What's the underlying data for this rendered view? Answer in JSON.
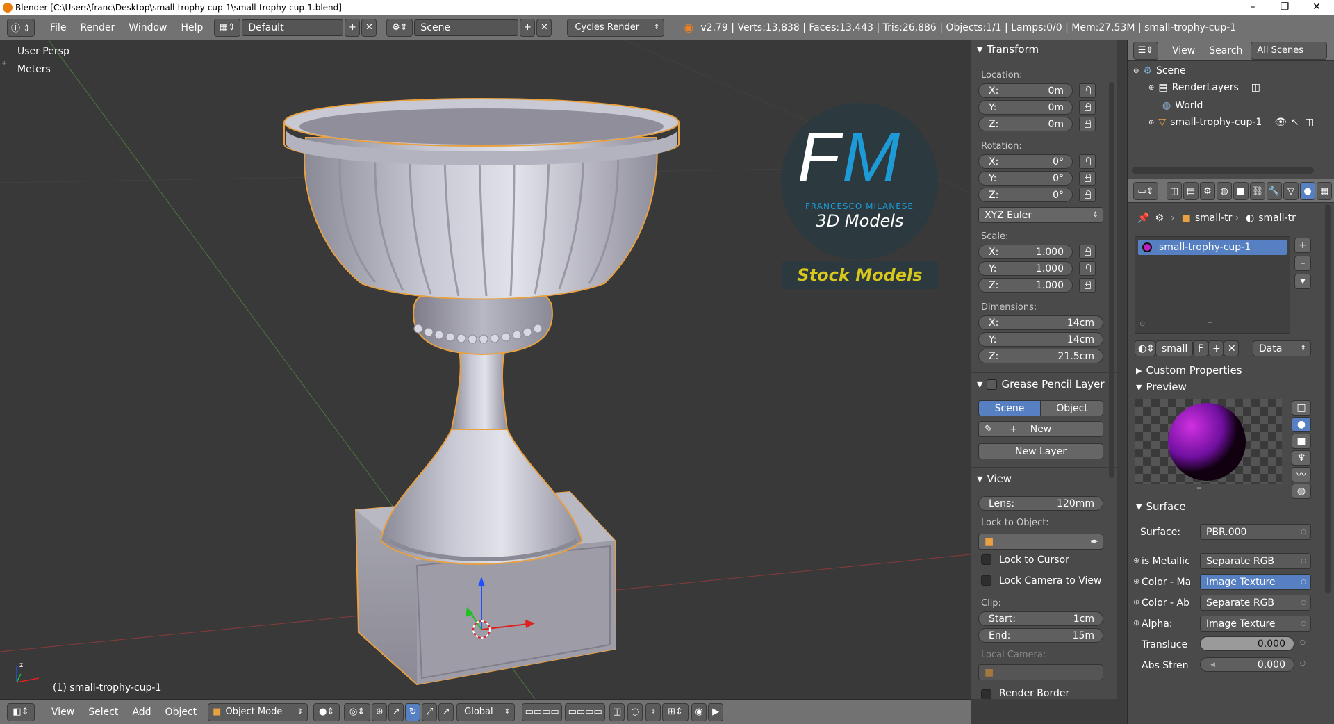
{
  "titlebar": {
    "title": "Blender [C:\\Users\\franc\\Desktop\\small-trophy-cup-1\\small-trophy-cup-1.blend]",
    "minimize": "–",
    "maximize": "❐",
    "close": "✕"
  },
  "header": {
    "menus": [
      "File",
      "Render",
      "Window",
      "Help"
    ],
    "layout": "Default",
    "scene": "Scene",
    "engine": "Cycles Render",
    "stats": "v2.79 | Verts:13,838 | Faces:13,443 | Tris:26,886 | Objects:1/1 | Lamps:0/0 | Mem:27.53M | small-trophy-cup-1"
  },
  "viewport": {
    "view_name": "User Persp",
    "units": "Meters",
    "object_label": "(1) small-trophy-cup-1",
    "watermark": {
      "initials_f": "F",
      "initials_m": "M",
      "name": "FRANCESCO MILANESE",
      "sub": "3D Models",
      "banner": "Stock Models"
    }
  },
  "bottombar": {
    "menus": [
      "View",
      "Select",
      "Add",
      "Object"
    ],
    "mode": "Object Mode",
    "orientation": "Global"
  },
  "npanel": {
    "transform_title": "Transform",
    "location_label": "Location:",
    "location": [
      {
        "axis": "X:",
        "value": "0m"
      },
      {
        "axis": "Y:",
        "value": "0m"
      },
      {
        "axis": "Z:",
        "value": "0m"
      }
    ],
    "rotation_label": "Rotation:",
    "rotation": [
      {
        "axis": "X:",
        "value": "0°"
      },
      {
        "axis": "Y:",
        "value": "0°"
      },
      {
        "axis": "Z:",
        "value": "0°"
      }
    ],
    "rotation_mode": "XYZ Euler",
    "scale_label": "Scale:",
    "scale": [
      {
        "axis": "X:",
        "value": "1.000"
      },
      {
        "axis": "Y:",
        "value": "1.000"
      },
      {
        "axis": "Z:",
        "value": "1.000"
      }
    ],
    "dimensions_label": "Dimensions:",
    "dimensions": [
      {
        "axis": "X:",
        "value": "14cm"
      },
      {
        "axis": "Y:",
        "value": "14cm"
      },
      {
        "axis": "Z:",
        "value": "21.5cm"
      }
    ],
    "grease_title": "Grease Pencil Layer",
    "gp_scene": "Scene",
    "gp_object": "Object",
    "gp_new": "New",
    "gp_new_layer": "New Layer",
    "view_title": "View",
    "lens_label": "Lens:",
    "lens_value": "120mm",
    "lock_to_object": "Lock to Object:",
    "lock_to_cursor": "Lock to Cursor",
    "lock_camera": "Lock Camera to View",
    "clip_label": "Clip:",
    "clip_start_label": "Start:",
    "clip_start": "1cm",
    "clip_end_label": "End:",
    "clip_end": "15m",
    "local_camera": "Local Camera:",
    "render_border": "Render Border"
  },
  "outliner": {
    "view": "View",
    "search": "Search",
    "all_scenes": "All Scenes",
    "items": [
      "Scene",
      "RenderLayers",
      "World",
      "small-trophy-cup-1"
    ]
  },
  "properties": {
    "breadcrumb_obj": "small-tr",
    "breadcrumb_mat": "small-tr",
    "material_slot": "small-trophy-cup-1",
    "mat_name": "small",
    "mat_fake": "F",
    "data_link": "Data",
    "custom_props": "Custom Properties",
    "preview": "Preview",
    "surface_title": "Surface",
    "surface_label": "Surface:",
    "surface_value": "PBR.000",
    "inputs": [
      {
        "label": "is Metallic",
        "value": "Separate RGB"
      },
      {
        "label": "Color - Ma",
        "value": "Image Texture"
      },
      {
        "label": "Color - Ab",
        "value": "Separate RGB"
      },
      {
        "label": "Alpha:",
        "value": "Image Texture"
      }
    ],
    "transluce_label": "Transluce",
    "transluce_value": "0.000",
    "abs_label": "Abs Stren",
    "abs_value": "0.000"
  },
  "colors": {
    "accent_blue": "#5680c2",
    "outline_orange": "#e8a040",
    "watermark_blue": "#1e9ad6",
    "watermark_yellow": "#d8c81c"
  }
}
